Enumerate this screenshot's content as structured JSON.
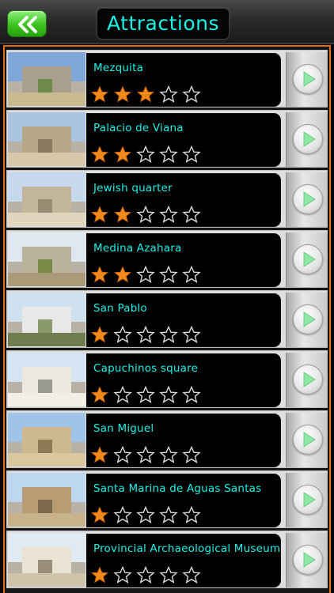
{
  "header": {
    "title": "Attractions",
    "back_icon": "double-chevron-left-icon"
  },
  "colors": {
    "accent_cyan": "#19f2e6",
    "frame_orange": "#e46d12",
    "star_filled": "#f08a1c",
    "back_green": "#3cc21f"
  },
  "attractions": [
    {
      "name": "Mezquita",
      "rating": 3,
      "max_rating": 5
    },
    {
      "name": "Palacio de Viana",
      "rating": 2,
      "max_rating": 5
    },
    {
      "name": "Jewish quarter",
      "rating": 2,
      "max_rating": 5
    },
    {
      "name": "Medina Azahara",
      "rating": 2,
      "max_rating": 5
    },
    {
      "name": "San Pablo",
      "rating": 1,
      "max_rating": 5
    },
    {
      "name": "Capuchinos square",
      "rating": 1,
      "max_rating": 5
    },
    {
      "name": "San Miguel",
      "rating": 1,
      "max_rating": 5
    },
    {
      "name": "Santa Marina de Aguas Santas",
      "rating": 1,
      "max_rating": 5
    },
    {
      "name": "Provincial Archaeological Museum",
      "rating": 1,
      "max_rating": 5
    }
  ]
}
